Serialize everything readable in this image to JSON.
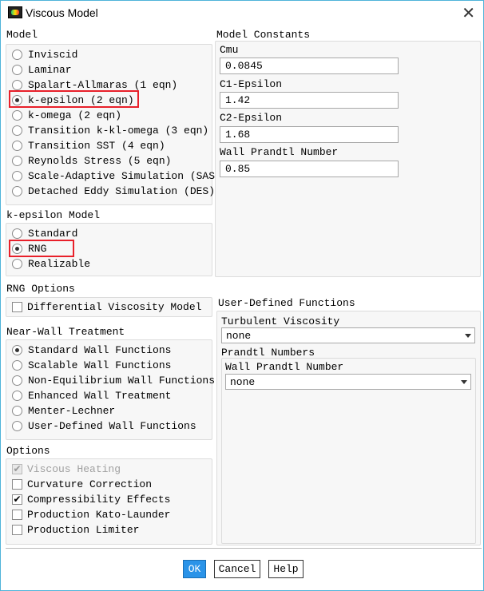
{
  "window": {
    "title": "Viscous Model",
    "close": "✕"
  },
  "model": {
    "label": "Model",
    "options": [
      "Inviscid",
      "Laminar",
      "Spalart-Allmaras (1 eqn)",
      "k-epsilon (2 eqn)",
      "k-omega (2 eqn)",
      "Transition k-kl-omega (3 eqn)",
      "Transition SST (4 eqn)",
      "Reynolds Stress (5 eqn)",
      "Scale-Adaptive Simulation (SAS)",
      "Detached Eddy Simulation (DES)"
    ],
    "selected": 3
  },
  "ke_model": {
    "label": "k-epsilon Model",
    "options": [
      "Standard",
      "RNG",
      "Realizable"
    ],
    "selected": 1
  },
  "rng_options": {
    "label": "RNG Options",
    "items": [
      {
        "label": "Differential Viscosity Model",
        "checked": false
      }
    ]
  },
  "near_wall": {
    "label": "Near-Wall Treatment",
    "options": [
      "Standard Wall Functions",
      "Scalable Wall Functions",
      "Non-Equilibrium Wall Functions",
      "Enhanced Wall Treatment",
      "Menter-Lechner",
      "User-Defined Wall Functions"
    ],
    "selected": 0
  },
  "options": {
    "label": "Options",
    "items": [
      {
        "label": "Viscous Heating",
        "checked": true,
        "disabled": true
      },
      {
        "label": "Curvature Correction",
        "checked": false
      },
      {
        "label": "Compressibility Effects",
        "checked": true
      },
      {
        "label": "Production Kato-Launder",
        "checked": false
      },
      {
        "label": "Production Limiter",
        "checked": false
      }
    ]
  },
  "constants": {
    "label": "Model Constants",
    "fields": [
      {
        "label": "Cmu",
        "value": "0.0845"
      },
      {
        "label": "C1-Epsilon",
        "value": "1.42"
      },
      {
        "label": "C2-Epsilon",
        "value": "1.68"
      },
      {
        "label": "Wall Prandtl Number",
        "value": "0.85"
      }
    ]
  },
  "udf": {
    "label": "User-Defined Functions",
    "turb_visc_label": "Turbulent Viscosity",
    "turb_visc_value": "none",
    "prandtl_label": "Prandtl Numbers",
    "wall_prandtl_label": "Wall Prandtl Number",
    "wall_prandtl_value": "none"
  },
  "buttons": {
    "ok": "OK",
    "cancel": "Cancel",
    "help": "Help"
  },
  "colors": {
    "accent": "#2a93e8",
    "highlight": "#e8202a"
  }
}
